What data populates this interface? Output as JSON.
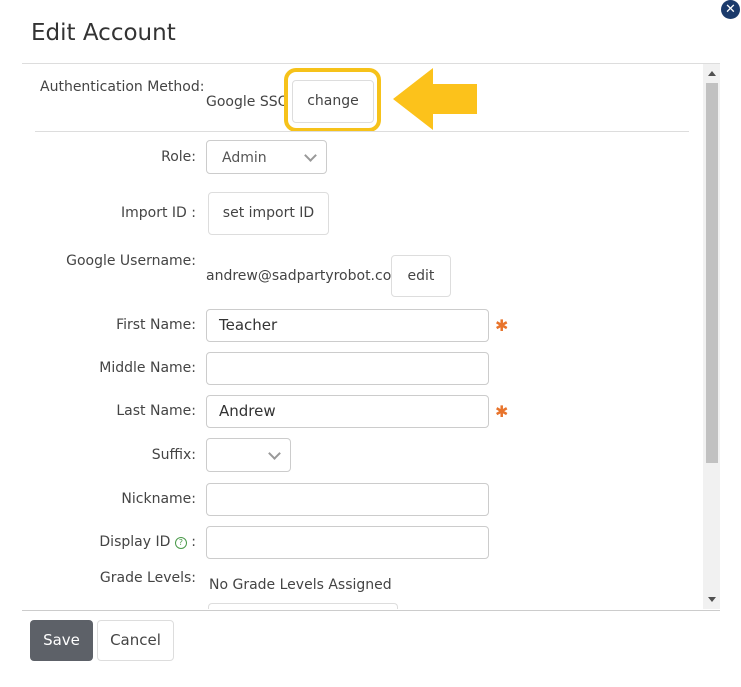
{
  "dialog": {
    "title": "Edit Account",
    "close_icon": "close-icon"
  },
  "form": {
    "auth_method": {
      "label": "Authentication Method:",
      "value": "Google SSO",
      "button": "change"
    },
    "role": {
      "label": "Role:",
      "value": "Admin"
    },
    "import_id": {
      "label": "Import ID :",
      "button": "set import ID"
    },
    "google_username": {
      "label": "Google Username:",
      "value": "andrew@sadpartyrobot.com",
      "button": "edit"
    },
    "first_name": {
      "label": "First Name:",
      "value": "Teacher",
      "required_marker": "✱"
    },
    "middle_name": {
      "label": "Middle Name:",
      "value": ""
    },
    "last_name": {
      "label": "Last Name:",
      "value": "Andrew",
      "required_marker": "✱"
    },
    "suffix": {
      "label": "Suffix:",
      "value": ""
    },
    "nickname": {
      "label": "Nickname:",
      "value": ""
    },
    "display_id": {
      "label": "Display ID",
      "label_suffix": ":",
      "value": ""
    },
    "grade_levels": {
      "label": "Grade Levels:",
      "value": "No Grade Levels Assigned"
    }
  },
  "footer": {
    "save_label": "Save",
    "cancel_label": "Cancel"
  },
  "colors": {
    "highlight": "#f6c21a",
    "arrow": "#fcc21b",
    "required": "#e8742c",
    "save_button": "#5d6168",
    "close_button": "#1b3a6b"
  }
}
